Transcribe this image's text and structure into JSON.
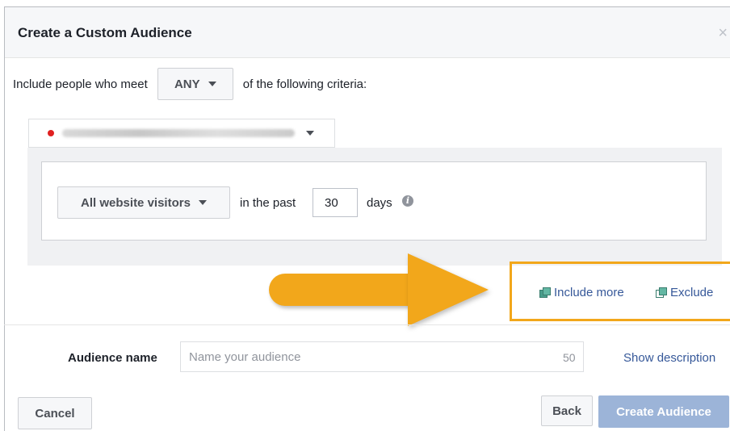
{
  "dialog": {
    "title": "Create a Custom Audience",
    "close_glyph": "×"
  },
  "criteria": {
    "prefix": "Include people who meet",
    "match_value": "ANY",
    "suffix": "of the following criteria:"
  },
  "rule": {
    "event_value": "All website visitors",
    "in_the_past_label": "in the past",
    "days_value": "30",
    "days_label": "days",
    "info_glyph": "i"
  },
  "actions": {
    "include_more": "Include more",
    "exclude": "Exclude"
  },
  "audience": {
    "name_label": "Audience name",
    "name_placeholder": "Name your audience",
    "char_count": "50",
    "show_description": "Show description"
  },
  "footer": {
    "cancel": "Cancel",
    "back": "Back",
    "create": "Create Audience"
  },
  "colors": {
    "accent_arrow": "#f2a71b",
    "link": "#365899",
    "primary_disabled": "#9cb4d8",
    "pixel_status": "#e02020"
  },
  "icons": {
    "pixel_status": "red-dot-icon",
    "include_more": "copy-squares-icon",
    "exclude": "copy-squares-outline-icon",
    "info": "info-icon",
    "close": "close-icon"
  }
}
